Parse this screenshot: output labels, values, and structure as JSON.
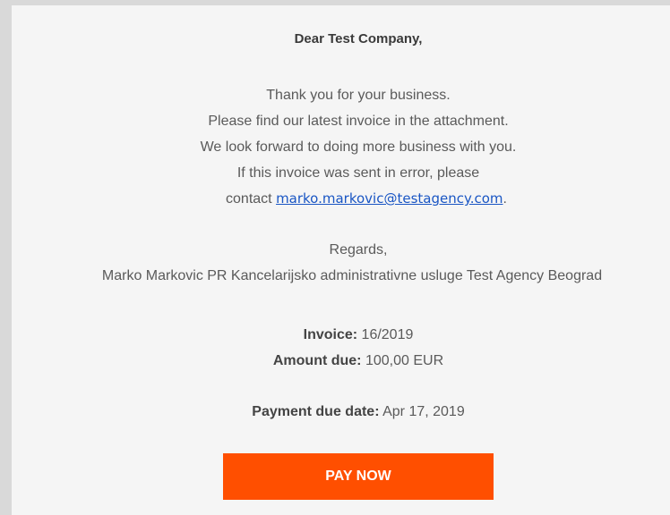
{
  "email": {
    "greeting": "Dear Test Company,",
    "lines": [
      "Thank you for your business.",
      "Please find our latest invoice in the attachment.",
      "We look forward to doing more business with you.",
      "If this invoice was sent in error, please"
    ],
    "contact_prefix": "contact ",
    "contact_email": "marko.markovic@testagency.com",
    "contact_suffix": ".",
    "regards": "Regards,",
    "sender": "Marko Markovic PR Kancelarijsko administrativne usluge Test Agency Beograd",
    "invoice_label": "Invoice:",
    "invoice_value": " 16/2019",
    "amount_label": "Amount due:",
    "amount_value": " 100,00 EUR",
    "due_label": "Payment due date:",
    "due_value": " Apr 17, 2019",
    "pay_button": "PAY NOW"
  },
  "colors": {
    "button": "#ff4f00",
    "link": "#1a56c4",
    "background": "#f5f5f5"
  }
}
